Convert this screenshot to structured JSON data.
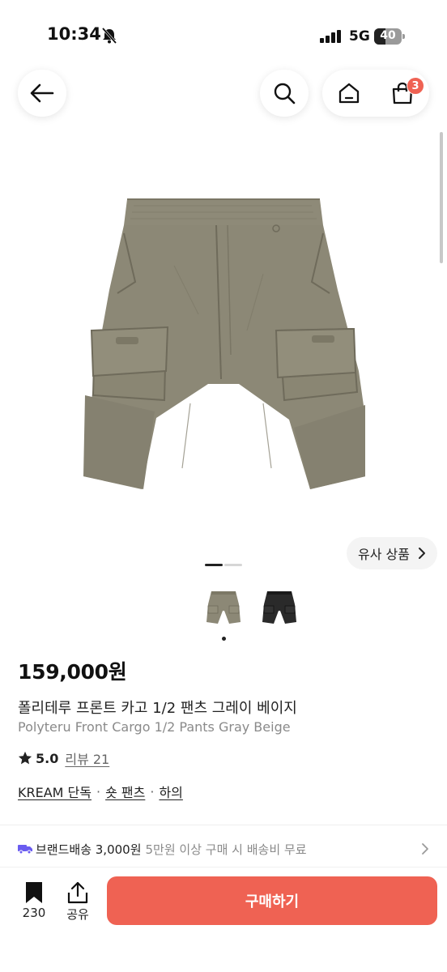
{
  "status_bar": {
    "time": "10:34",
    "network": "5G",
    "battery": "40",
    "battery_level_percent": 40
  },
  "nav": {
    "cart_count": "3"
  },
  "icons": {
    "back": "arrow-left-icon",
    "search": "search-icon",
    "home": "home-icon",
    "cart": "shopping-bag-icon",
    "bookmark": "bookmark-icon",
    "share": "share-icon",
    "truck": "truck-icon",
    "star": "star-icon"
  },
  "gallery": {
    "similar_button": "유사 상품",
    "page_count": 2,
    "current_page": 1
  },
  "variants": [
    {
      "color": "gray beige",
      "selected": true
    },
    {
      "color": "black",
      "selected": false
    }
  ],
  "product": {
    "price": "159,000원",
    "name_ko": "폴리테루 프론트 카고 1/2 팬츠 그레이 베이지",
    "name_en": "Polyteru Front Cargo 1/2 Pants Gray Beige",
    "rating": "5.0",
    "review_label": "리뷰 21",
    "tags": [
      "KREAM 단독",
      "숏 팬츠",
      "하의"
    ],
    "tag_separator": "·"
  },
  "shipping": {
    "label": "브랜드배송 3,000원",
    "note": "5만원 이상 구매 시 배송비 무료"
  },
  "actions": {
    "bookmark_count": "230",
    "share_label": "공유",
    "buy_label": "구매하기"
  },
  "colors": {
    "accent": "#ef6253",
    "shipping_icon": "#6a5cf0",
    "product_fabric": "#8c8876",
    "variant_black": "#2a2a2a"
  }
}
